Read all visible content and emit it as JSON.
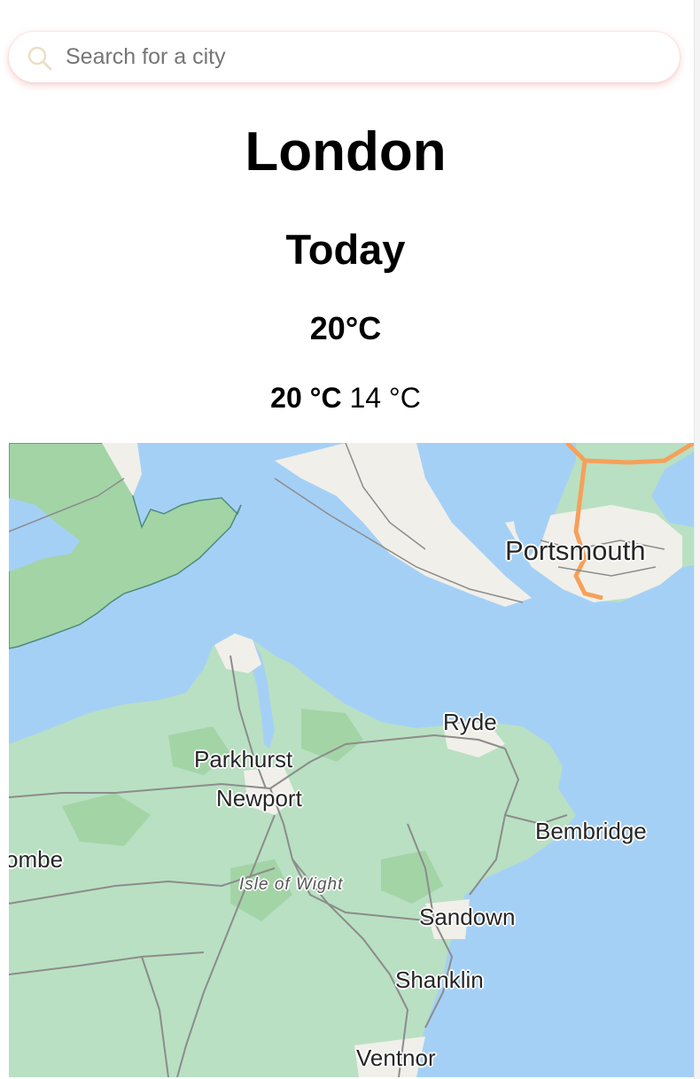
{
  "search": {
    "placeholder": "Search for a city",
    "value": ""
  },
  "weather": {
    "city": "London",
    "day": "Today",
    "current_temp": "20°C",
    "max_temp": "20 °C",
    "min_temp": "14 °C"
  },
  "map": {
    "labels": {
      "portsmouth": "Portsmouth",
      "ryde": "Ryde",
      "parkhurst": "Parkhurst",
      "newport": "Newport",
      "bembridge": "Bembridge",
      "yarmouth_partial": "ombe",
      "isle_of_wight": "Isle of Wight",
      "sandown": "Sandown",
      "shanklin": "Shanklin",
      "ventnor": "Ventnor"
    },
    "colors": {
      "water": "#a5d0f6",
      "land_green": "#b9e0c2",
      "park_green": "#a3d4a6",
      "urban": "#f1efe9",
      "motorway": "#f6a05a"
    }
  }
}
